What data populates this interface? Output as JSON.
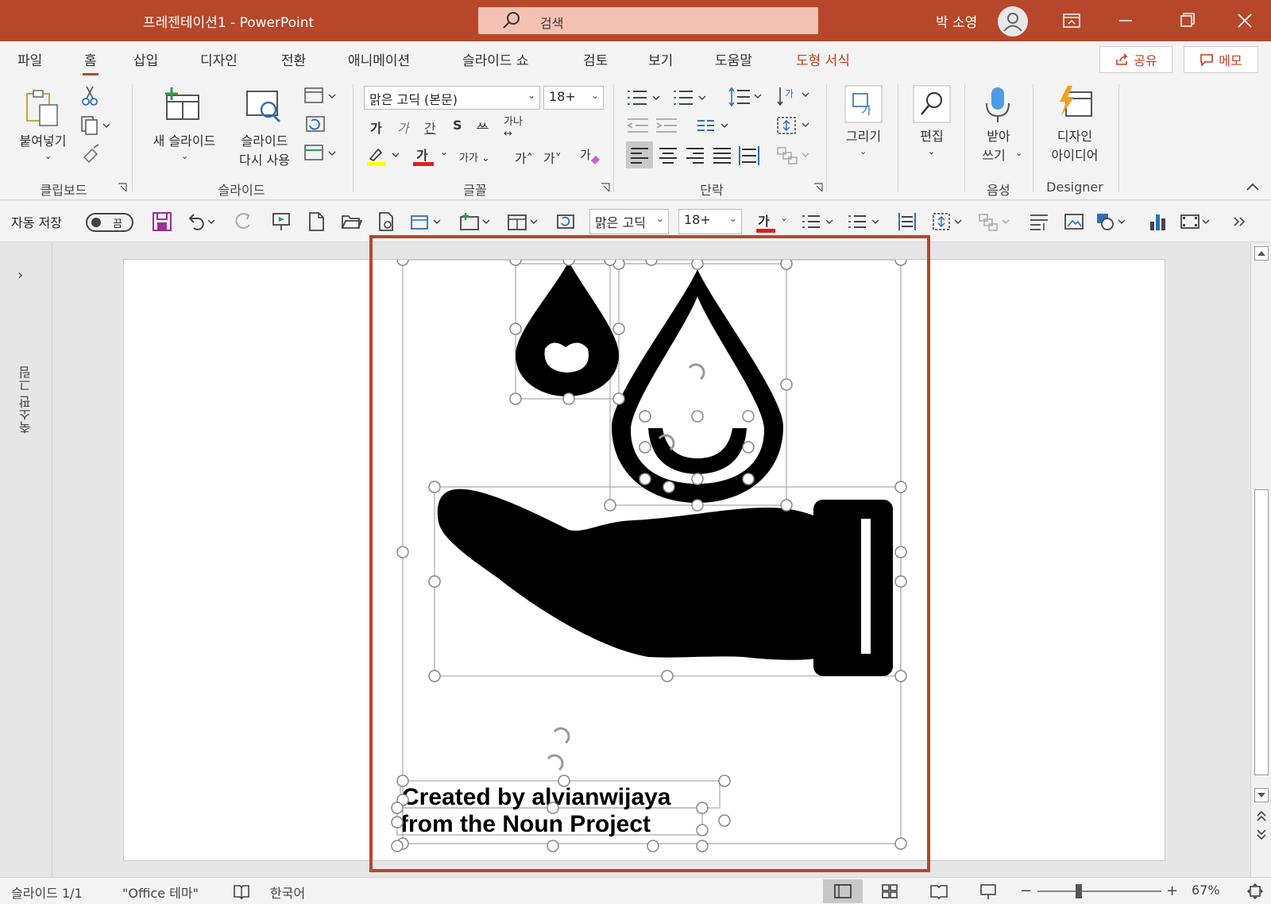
{
  "titlebar": {
    "title": "프레젠테이션1  -  PowerPoint",
    "search_placeholder": "검색",
    "user_name": "박 소영"
  },
  "tabs": [
    "파일",
    "홈",
    "삽입",
    "디자인",
    "전환",
    "애니메이션",
    "슬라이드 쇼",
    "검토",
    "보기",
    "도움말",
    "도형 서식"
  ],
  "active_tab": "홈",
  "share_label": "공유",
  "comment_label": "메모",
  "ribbon": {
    "clipboard": {
      "paste": "붙여넣기",
      "group": "클립보드"
    },
    "slides": {
      "new_slide": "새 슬라이드",
      "reuse_1": "슬라이드",
      "reuse_2": "다시 사용",
      "group": "슬라이드"
    },
    "font": {
      "font_name": "맑은 고딕 (본문)",
      "font_size": "18+",
      "group": "글꼴"
    },
    "paragraph": {
      "group": "단락"
    },
    "drawing": {
      "label": "그리기"
    },
    "editing": {
      "label": "편집"
    },
    "voice": {
      "label_1": "받아",
      "label_2": "쓰기",
      "group": "음성"
    },
    "designer": {
      "label_1": "디자인",
      "label_2": "아이디어",
      "group": "Designer"
    }
  },
  "qat": {
    "autosave_label": "자동 저장",
    "autosave_state": "끔",
    "font_name": "맑은 고딕",
    "font_size": "18+"
  },
  "thumbnail_pane": {
    "label": "축소판 그림"
  },
  "slide": {
    "credit_line1": "Created by alvianwijaya",
    "credit_line2": "from the Noun Project"
  },
  "status": {
    "slide_num": "슬라이드 1/1",
    "theme": "\"Office 테마\"",
    "language": "한국어",
    "zoom": "67%"
  },
  "colors": {
    "brand": "#b7472a",
    "accent_text": "#c43e1c",
    "highlight_yellow": "#ffff00",
    "font_red": "#e02020"
  }
}
